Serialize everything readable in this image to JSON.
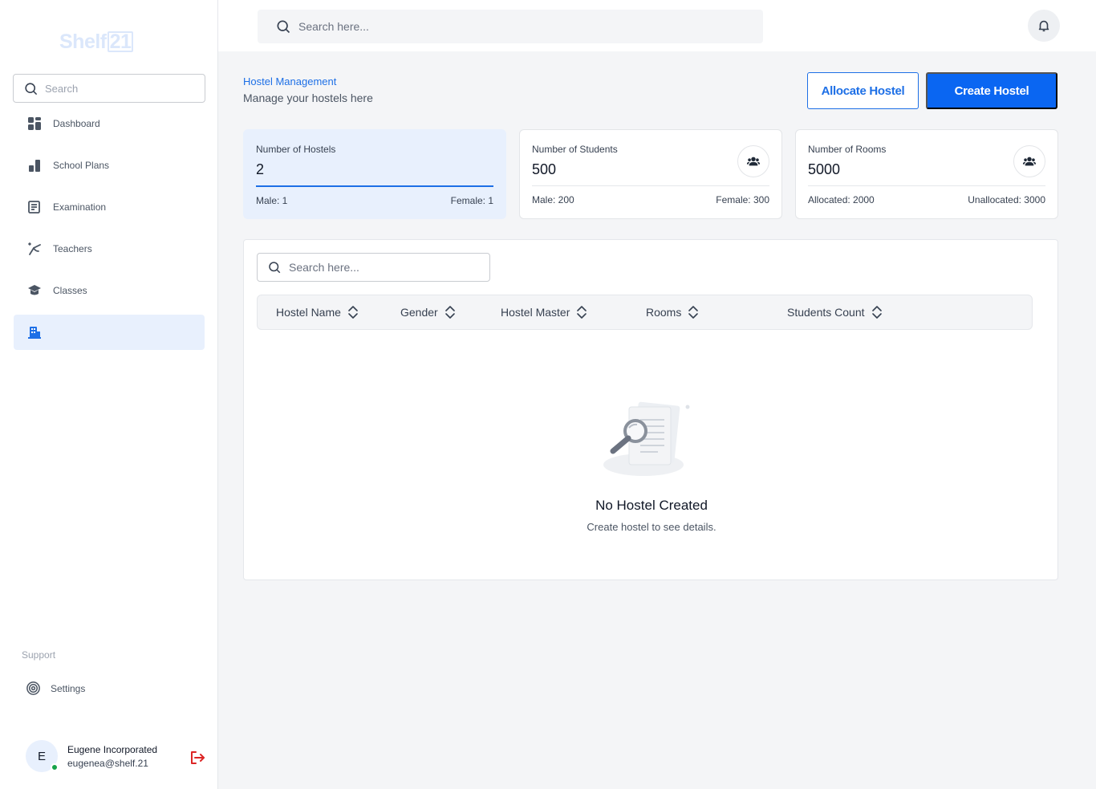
{
  "app": {
    "logo_text": "Shelf",
    "logo_box": "21"
  },
  "sidebar": {
    "search_placeholder": "Search",
    "items": [
      {
        "label": "Dashboard",
        "icon": "dashboard-grid-icon"
      },
      {
        "label": "School Plans",
        "icon": "bar-chart-icon"
      },
      {
        "label": "Examination",
        "icon": "document-icon"
      },
      {
        "label": "Teachers",
        "icon": "teacher-icon"
      },
      {
        "label": "Classes",
        "icon": "graduation-cap-icon"
      },
      {
        "label": "",
        "icon": "building-icon",
        "active": true
      }
    ],
    "support_label": "Support",
    "settings_label": "Settings",
    "user": {
      "initial": "E",
      "name": "Eugene Incorporated",
      "email": "eugenea@shelf.21"
    }
  },
  "topbar": {
    "search_placeholder": "Search here..."
  },
  "page": {
    "title": "Hostel Management",
    "subtitle": "Manage your hostels here",
    "allocate_label": "Allocate Hostel",
    "create_label": "Create Hostel"
  },
  "stats": [
    {
      "label": "Number of Hostels",
      "value": "2",
      "left": "Male: 1",
      "right": "Female: 1"
    },
    {
      "label": "Number of Students",
      "value": "500",
      "left": "Male: 200",
      "right": "Female: 300"
    },
    {
      "label": "Number of Rooms",
      "value": "5000",
      "left": "Allocated: 2000",
      "right": "Unallocated: 3000"
    }
  ],
  "table": {
    "search_placeholder": "Search here...",
    "columns": [
      "Hostel Name",
      "Gender",
      "Hostel Master",
      "Rooms",
      "Students Count"
    ],
    "empty_title": "No Hostel Created",
    "empty_subtitle": "Create hostel to see details."
  },
  "colors": {
    "accent": "#0a66f2",
    "accent_text": "#1d6fe6",
    "highlight_bg": "#e8f0fd",
    "online": "#16a34a",
    "logout": "#dc2626"
  }
}
